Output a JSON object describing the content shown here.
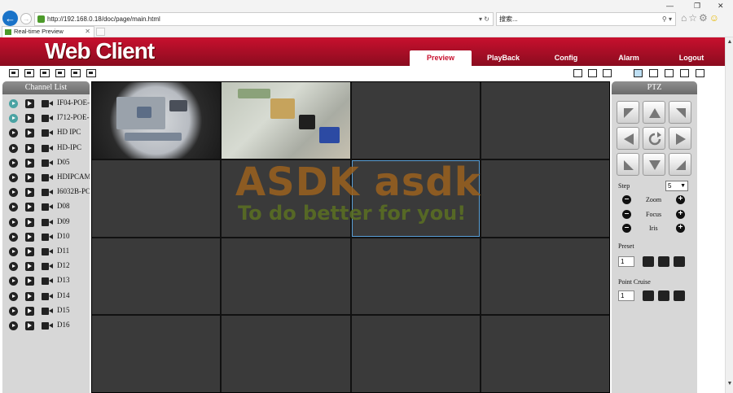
{
  "browser": {
    "url": "http://192.168.0.18/doc/page/main.html",
    "search_placeholder": "搜索...",
    "tab_title": "Real-time Preview"
  },
  "app": {
    "brand": "Web Client",
    "nav": [
      {
        "label": "Preview",
        "active": true
      },
      {
        "label": "PlayBack",
        "active": false
      },
      {
        "label": "Config",
        "active": false
      },
      {
        "label": "Alarm",
        "active": false
      },
      {
        "label": "Logout",
        "active": false
      }
    ]
  },
  "channel_list": {
    "title": "Channel List",
    "channels": [
      {
        "name": "IF04-POE-",
        "playing": true
      },
      {
        "name": "I712-POE-",
        "playing": true
      },
      {
        "name": "HD IPC",
        "playing": false
      },
      {
        "name": "HD-IPC",
        "playing": false
      },
      {
        "name": "D05",
        "playing": false
      },
      {
        "name": "HDIPCAM",
        "playing": false
      },
      {
        "name": "I6032B-PO",
        "playing": false
      },
      {
        "name": "D08",
        "playing": false
      },
      {
        "name": "D09",
        "playing": false
      },
      {
        "name": "D10",
        "playing": false
      },
      {
        "name": "D11",
        "playing": false
      },
      {
        "name": "D12",
        "playing": false
      },
      {
        "name": "D13",
        "playing": false
      },
      {
        "name": "D14",
        "playing": false
      },
      {
        "name": "D15",
        "playing": false
      },
      {
        "name": "D16",
        "playing": false
      }
    ]
  },
  "watermark": {
    "line1": "ASDK asdk",
    "line2": "To do better for you!"
  },
  "ptz": {
    "title": "PTZ",
    "step_label": "Step",
    "step_value": "5",
    "zoom_label": "Zoom",
    "focus_label": "Focus",
    "iris_label": "Iris",
    "preset_label": "Preset",
    "preset_value": "1",
    "cruise_label": "Point Cruise",
    "cruise_value": "1"
  },
  "colors": {
    "header_red": "#c8102e",
    "panel_grey": "#d7d7d7",
    "cell_grey": "#3a3a3a",
    "selection_blue": "#5aa0d8"
  }
}
